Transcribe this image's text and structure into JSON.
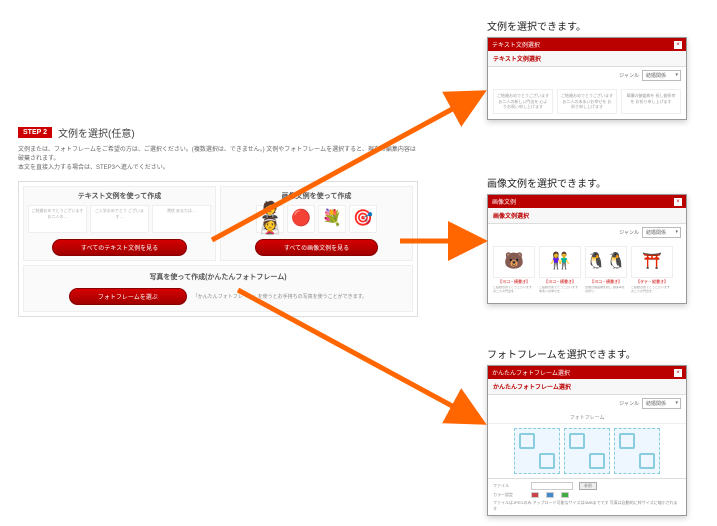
{
  "main": {
    "step_badge": "STEP 2",
    "step_title": "文例を選択(任意)",
    "description1": "文例または、フォトフレームをご希望の方は、ご選択ください。(複数選択は、できません。) 文例やフォトフレームを選択すると、現在の編集内容は破棄されます。",
    "description2": "本文を直接入力する場合は、STEP3へ進んでください。",
    "text_col_title": "テキスト文例を使って作成",
    "image_col_title": "画像文例を使って作成",
    "text_btn": "すべてのテキスト文例を見る",
    "image_btn": "すべての画像文例を見る",
    "photo_title": "写真を使って作成(かんたんフォトフレーム)",
    "photo_btn": "フォトフレームを選ぶ",
    "photo_desc": "「かんたんフォトフレーム」を使うとお手持ちの写真を使うことができます。",
    "text_samples": [
      "ご結婚おめでとうございます お二人の…",
      "ご入学おめでとう ございます…",
      "賞状 あなたは…"
    ]
  },
  "callouts": {
    "text": "文例を選択できます。",
    "image": "画像文例を選択できます。",
    "photo": "フォトフレームを選択できます。"
  },
  "popup_text": {
    "titlebar": "テキスト文例選択",
    "heading": "テキスト文例選択",
    "genre_label": "ジャンル",
    "genre_value": "結婚関係",
    "cards": [
      "ご結婚おめでとうございます お二人の新しい門出を 心よりお祝い申し上げます",
      "ご結婚おめでとうございます お二人の末永いお幸せを お祈り申し上げます",
      "華燭の御盛典を 祝し御多幸を お祈り申し上げます"
    ]
  },
  "popup_image": {
    "titlebar": "画像文例",
    "heading": "画像文例選択",
    "genre_label": "ジャンル",
    "genre_value": "結婚関係",
    "cards": [
      {
        "tag": "【ヨコ・横書き】",
        "txt": "ご結婚おめでとうございます お二人の門出を…"
      },
      {
        "tag": "【ヨコ・横書き】",
        "txt": "ご結婚おめでとうございます 末永いお幸せを…"
      },
      {
        "tag": "【ヨコ・横書き】",
        "txt": "華燭の御盛典を祝し 御多幸をお祈り…"
      },
      {
        "tag": "【タテ・縦書き】",
        "txt": "ご結婚おめでとうございます お二人の門出を…"
      }
    ]
  },
  "popup_photo": {
    "titlebar": "かんたんフォトフレーム選択",
    "heading": "かんたんフォトフレーム選択",
    "genre_label": "ジャンル",
    "genre_value": "結婚関係",
    "section": "フォトフレーム",
    "footer_file": "ファイル",
    "footer_browse": "参照",
    "footer_color": "カラー設定",
    "footer_note": "ファイルはJPEGのみ アップロード可能なサイズは3MBまでです 写真は自動的に枠サイズに縮小されます"
  }
}
